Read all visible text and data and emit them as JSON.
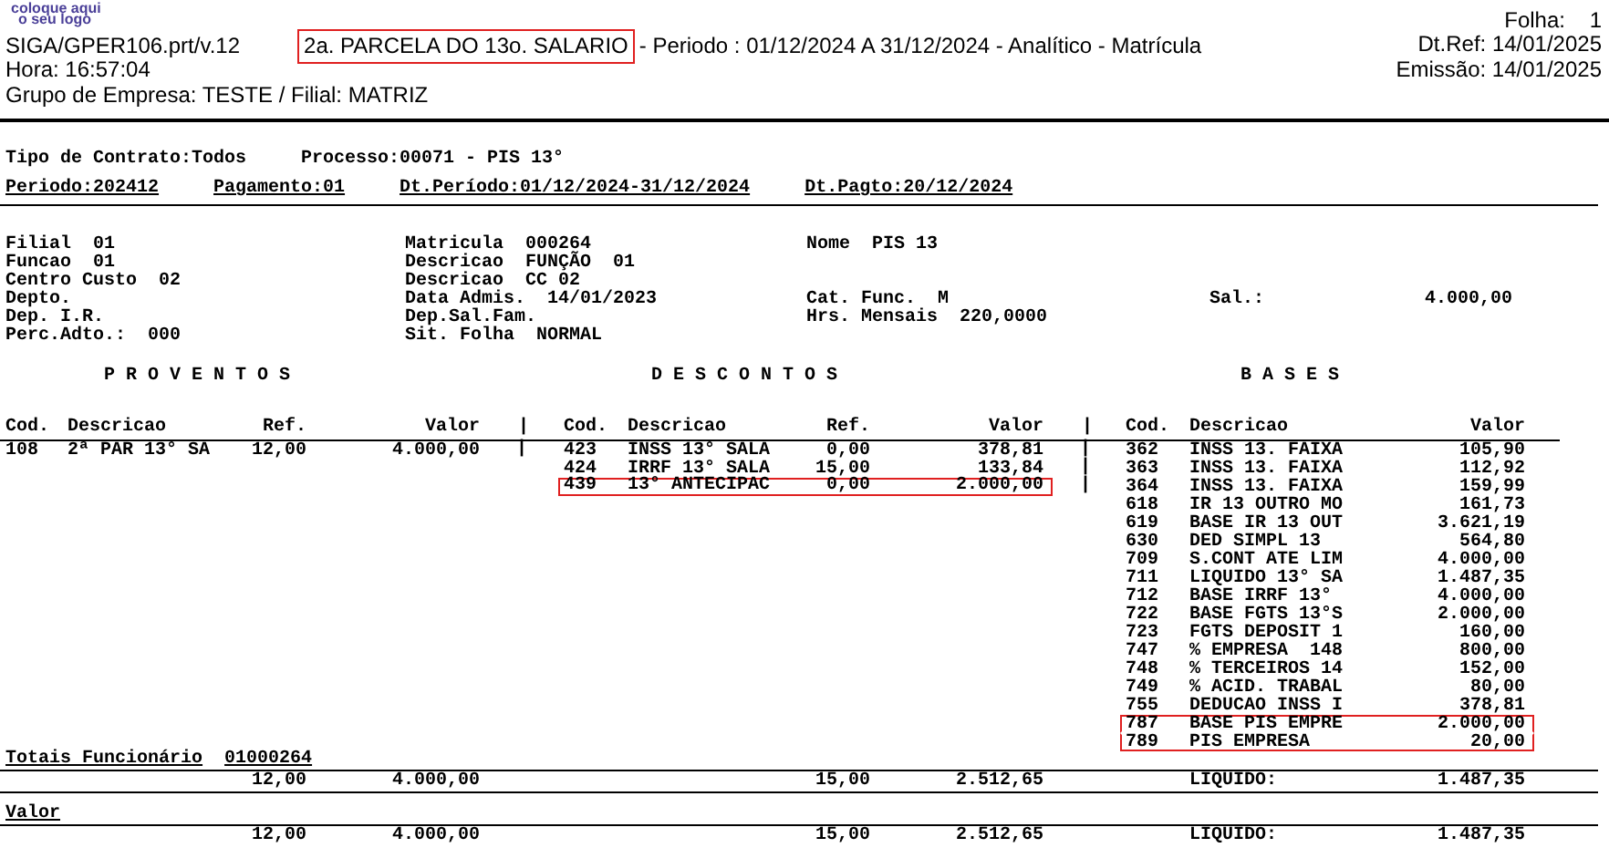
{
  "header": {
    "logo": [
      "coloque aqui",
      "o seu logo"
    ],
    "program": "SIGA/GPER106.prt/v.12",
    "title": {
      "text": "2a. PARCELA DO 13o. SALARIO",
      "highlighted": true
    },
    "subtitle": "- Periodo : 01/12/2024 A 31/12/2024 - Analítico - Matrícula",
    "time": "Hora: 16:57:04",
    "group": "Grupo de Empresa: TESTE / Filial: MATRIZ",
    "page_label": "Folha:",
    "page_number": "1",
    "ref_date": "Dt.Ref: 14/01/2025",
    "issue_date": "Emissão: 14/01/2025"
  },
  "filters": [
    {
      "underlined": false,
      "items": [
        "Tipo de Contrato:Todos",
        "Processo:00071 - PIS 13°"
      ]
    },
    {
      "underlined": true,
      "items": [
        "Periodo:202412",
        "Pagamento:01",
        "Dt.Período:01/12/2024-31/12/2024",
        "Dt.Pagto:20/12/2024"
      ]
    }
  ],
  "employee": {
    "lines": [
      {
        "fields": [
          {
            "kind": "left",
            "label": "Filial",
            "value": "01"
          },
          {
            "kind": "middle",
            "label": "Matricula",
            "value": "000264"
          },
          {
            "kind": "right",
            "label": "Nome",
            "value": "PIS 13"
          }
        ]
      },
      {
        "fields": [
          {
            "kind": "left",
            "label": "Funcao",
            "value": "01"
          },
          {
            "kind": "middle",
            "label": "Descricao",
            "value": "FUNÇÃO  01"
          }
        ]
      },
      {
        "fields": [
          {
            "kind": "left",
            "label": "Centro Custo",
            "value": "02"
          },
          {
            "kind": "middle",
            "label": "Descricao",
            "value": "CC 02"
          }
        ]
      },
      {
        "fields": [
          {
            "kind": "left",
            "label": "Depto."
          },
          {
            "kind": "middle",
            "label": "Data Admis.",
            "value": "14/01/2023"
          },
          {
            "kind": "right",
            "label": "Cat. Func.",
            "value": "M"
          },
          {
            "kind": "salary",
            "label": "Sal.:",
            "value": "4.000,00"
          }
        ]
      },
      {
        "fields": [
          {
            "kind": "left",
            "label": "Dep. I.R."
          },
          {
            "kind": "middle",
            "label": "Dep.Sal.Fam."
          },
          {
            "kind": "right",
            "label": "Hrs. Mensais",
            "value": "220,0000"
          }
        ]
      },
      {
        "fields": [
          {
            "kind": "left",
            "label": "Perc.Adto.:",
            "value": "000"
          },
          {
            "kind": "middle",
            "label": "Sit. Folha",
            "value": "NORMAL"
          }
        ]
      }
    ]
  },
  "separator": "|",
  "sections": [
    {
      "kind": "proventos",
      "title": "P R O V E N T O S",
      "columns": [
        "Cod.",
        "Descricao",
        "Ref.",
        "Valor"
      ],
      "rows": [
        {
          "code": "108",
          "description": "2ª PAR 13° SA",
          "ref": "12,00",
          "value": "4.000,00",
          "highlighted": false
        }
      ]
    },
    {
      "kind": "descontos",
      "title": "D E S C O N T O S",
      "columns": [
        "Cod.",
        "Descricao",
        "Ref.",
        "Valor"
      ],
      "rows": [
        {
          "code": "423",
          "description": "INSS 13° SALA",
          "ref": "0,00",
          "value": "378,81",
          "highlighted": false
        },
        {
          "code": "424",
          "description": "IRRF 13° SALA",
          "ref": "15,00",
          "value": "133,84",
          "highlighted": false
        },
        {
          "code": "439",
          "description": "13° ANTECIPAC",
          "ref": "0,00",
          "value": "2.000,00",
          "highlighted": true
        }
      ]
    },
    {
      "kind": "bases",
      "title": "B A S E S",
      "columns": [
        "Cod.",
        "Descricao",
        "Valor"
      ],
      "rows": [
        {
          "code": "362",
          "description": "INSS 13. FAIXA",
          "value": "105,90",
          "highlighted": false
        },
        {
          "code": "363",
          "description": "INSS 13. FAIXA",
          "value": "112,92",
          "highlighted": false
        },
        {
          "code": "364",
          "description": "INSS 13. FAIXA",
          "value": "159,99",
          "highlighted": false
        },
        {
          "code": "618",
          "description": "IR 13 OUTRO MO",
          "value": "161,73",
          "highlighted": false
        },
        {
          "code": "619",
          "description": "BASE IR 13 OUT",
          "value": "3.621,19",
          "highlighted": false
        },
        {
          "code": "630",
          "description": "DED SIMPL 13",
          "value": "564,80",
          "highlighted": false
        },
        {
          "code": "709",
          "description": "S.CONT ATE LIM",
          "value": "4.000,00",
          "highlighted": false
        },
        {
          "code": "711",
          "description": "LIQUIDO 13° SA",
          "value": "1.487,35",
          "highlighted": false
        },
        {
          "code": "712",
          "description": "BASE IRRF 13°",
          "value": "4.000,00",
          "highlighted": false
        },
        {
          "code": "722",
          "description": "BASE FGTS 13°S",
          "value": "2.000,00",
          "highlighted": false
        },
        {
          "code": "723",
          "description": "FGTS DEPOSIT 1",
          "value": "160,00",
          "highlighted": false
        },
        {
          "code": "747",
          "description": "% EMPRESA  148",
          "value": "800,00",
          "highlighted": false
        },
        {
          "code": "748",
          "description": "% TERCEIROS 14",
          "value": "152,00",
          "highlighted": false
        },
        {
          "code": "749",
          "description": "% ACID. TRABAL",
          "value": "80,00",
          "highlighted": false
        },
        {
          "code": "755",
          "description": "DEDUCAO INSS I",
          "value": "378,81",
          "highlighted": false
        },
        {
          "code": "787",
          "description": "BASE PIS EMPRE",
          "value": "2.000,00",
          "highlighted": true
        },
        {
          "code": "789",
          "description": "PIS EMPRESA",
          "value": "20,00",
          "highlighted": true
        }
      ]
    }
  ],
  "totals": [
    {
      "label": "Totais Funcionário",
      "code": "01000264",
      "values": [
        "12,00",
        "4.000,00",
        "15,00",
        "2.512,65",
        "LIQUIDO:",
        "1.487,35"
      ]
    },
    {
      "label": "Valor",
      "values": [
        "12,00",
        "4.000,00",
        "15,00",
        "2.512,65",
        "LIQUIDO:",
        "1.487,35"
      ]
    }
  ]
}
